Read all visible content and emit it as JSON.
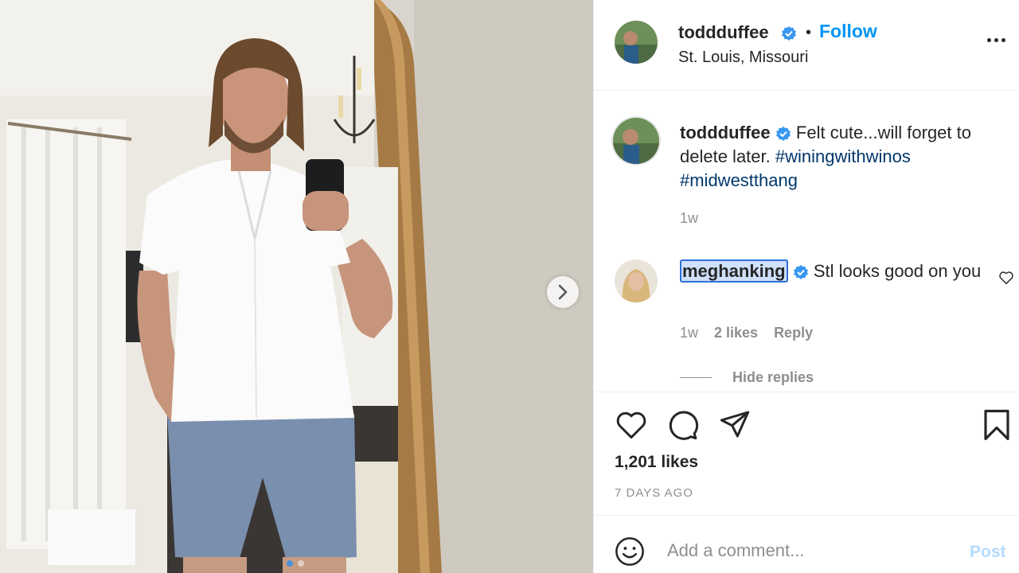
{
  "post": {
    "username": "toddduffee",
    "verified": true,
    "separator": "•",
    "follow_label": "Follow",
    "location": "St. Louis, Missouri",
    "more_icon": "more-options-icon"
  },
  "caption": {
    "username": "toddduffee",
    "text": "Felt cute...will forget to delete later.",
    "hashtags": [
      "#winingwithwinos",
      "#midwestthang"
    ],
    "time": "1w"
  },
  "comment": {
    "username": "meghanking",
    "verified": true,
    "text": "Stl looks good on you",
    "time": "1w",
    "likes": "2 likes",
    "reply_label": "Reply"
  },
  "replies": {
    "toggle_label": "Hide replies"
  },
  "actions": {
    "likes": "1,201 likes",
    "date": "7 DAYS AGO",
    "icons": [
      "heart-icon",
      "comment-icon",
      "share-icon",
      "bookmark-icon"
    ]
  },
  "add_comment": {
    "placeholder": "Add a comment...",
    "post_label": "Post"
  },
  "carousel": {
    "slide_count": 2,
    "active_index": 0
  },
  "colors": {
    "accent": "#0095f6",
    "hashtag": "#00376b",
    "muted": "#8e8e8e",
    "post_disabled": "#b3dbff"
  }
}
